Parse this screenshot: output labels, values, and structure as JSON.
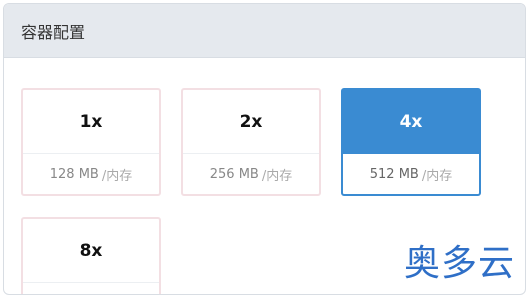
{
  "panel": {
    "title": "容器配置"
  },
  "options": [
    {
      "multiplier": "1x",
      "memory": "128 MB",
      "unit": "/内存",
      "selected": false
    },
    {
      "multiplier": "2x",
      "memory": "256 MB",
      "unit": "/内存",
      "selected": false
    },
    {
      "multiplier": "4x",
      "memory": "512 MB",
      "unit": "/内存",
      "selected": true
    },
    {
      "multiplier": "8x",
      "memory": "",
      "unit": "",
      "selected": false
    }
  ],
  "watermark": {
    "text": "奥多云"
  },
  "colors": {
    "accent": "#3a8bd2",
    "header_bg": "#e5e9ee",
    "card_border": "#f3dfe3"
  }
}
